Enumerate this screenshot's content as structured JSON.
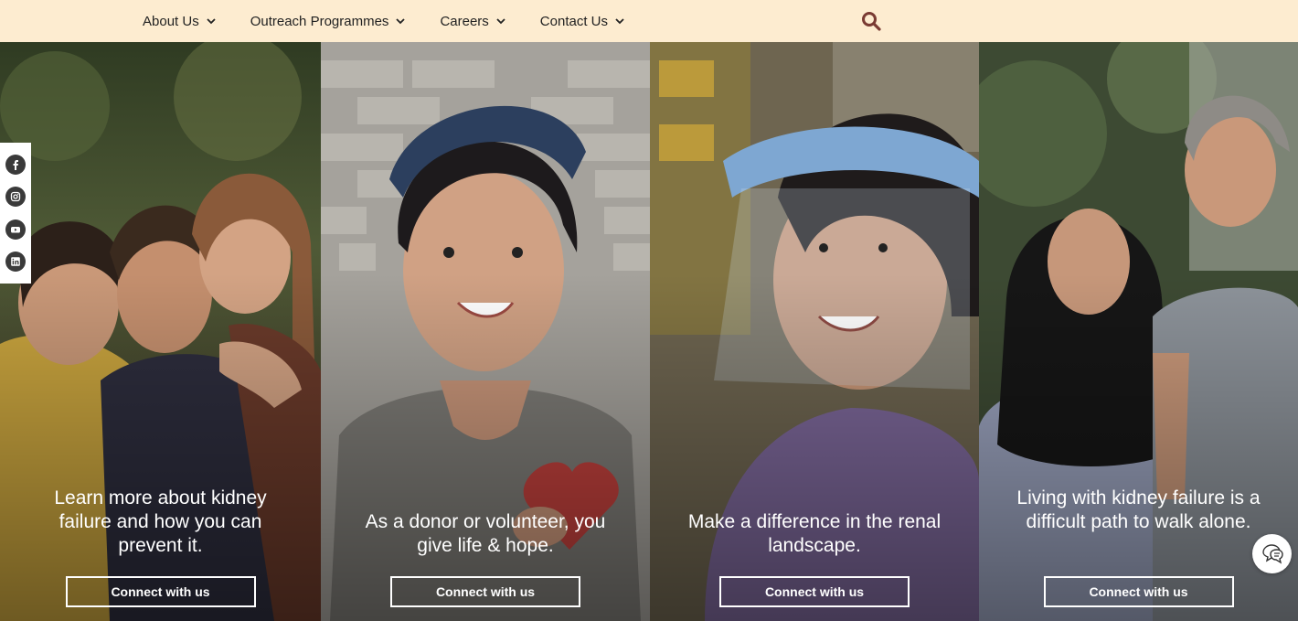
{
  "nav": {
    "items": [
      {
        "label": "About Us"
      },
      {
        "label": "Outreach Programmes"
      },
      {
        "label": "Careers"
      },
      {
        "label": "Contact Us"
      }
    ],
    "search_icon": "search-icon"
  },
  "social": {
    "icons": [
      "facebook-icon",
      "instagram-icon",
      "youtube-icon",
      "linkedin-icon"
    ]
  },
  "panels": [
    {
      "text": "Learn more about kidney failure and how you can prevent it.",
      "cta": "Connect with us"
    },
    {
      "text": "As a donor or volunteer, you give life & hope.",
      "cta": "Connect with us"
    },
    {
      "text": "Make a difference in the renal landscape.",
      "cta": "Connect with us"
    },
    {
      "text": "Living with kidney failure is a difficult path to walk alone.",
      "cta": "Connect with us"
    }
  ],
  "chat_icon": "chat-icon",
  "colors": {
    "topbar": "#fdecd0",
    "search_icon": "#7a3b33"
  }
}
